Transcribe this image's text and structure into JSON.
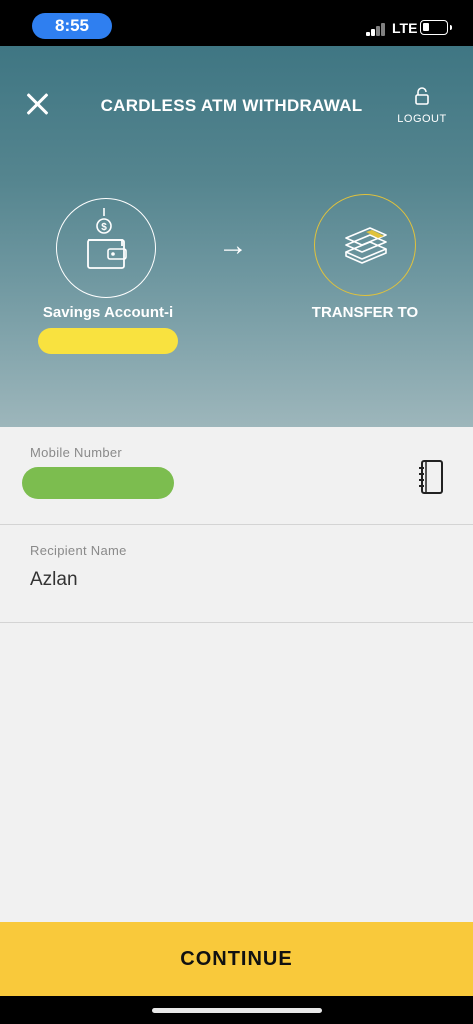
{
  "status_bar": {
    "time": "8:55",
    "network": "LTE",
    "battery_level": 0.3
  },
  "header": {
    "title": "CARDLESS ATM WITHDRAWAL",
    "logout_label": "LOGOUT"
  },
  "flow": {
    "from_label": "Savings Account-i",
    "to_label": "TRANSFER TO"
  },
  "form": {
    "mobile": {
      "label": "Mobile Number",
      "value": ""
    },
    "recipient": {
      "label": "Recipient Name",
      "value": "Azlan"
    }
  },
  "actions": {
    "continue_label": "CONTINUE"
  },
  "colors": {
    "accent_yellow": "#f9c93b",
    "header_teal": "#4e7f8a"
  },
  "icons": [
    "close-icon",
    "lock-icon",
    "wallet-icon",
    "arrow-right-icon",
    "money-stack-icon",
    "contacts-book-icon"
  ]
}
